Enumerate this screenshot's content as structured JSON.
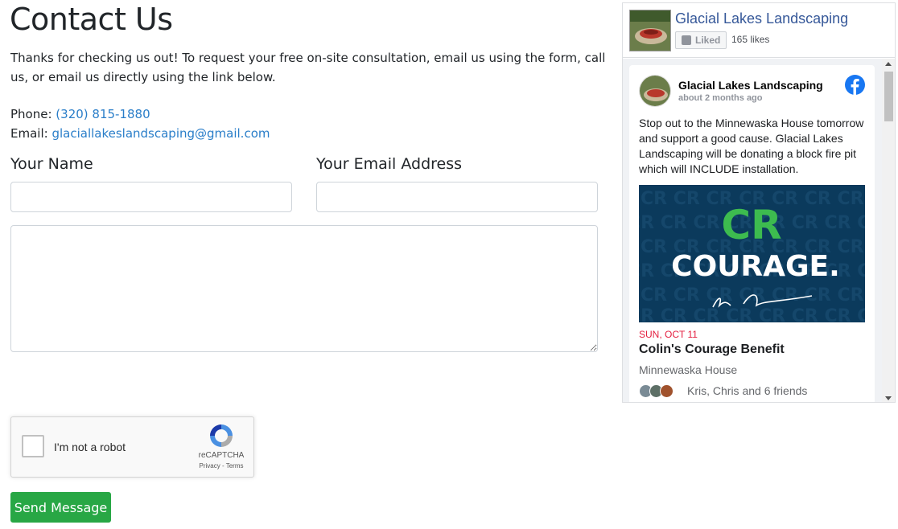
{
  "page": {
    "title": "Contact Us",
    "intro": "Thanks for checking us out! To request your free on-site consultation, email us using the form, call us, or email us directly using the link below.",
    "phone_label": "Phone",
    "phone": "(320) 815-1880",
    "email_label": "Email",
    "email": "glaciallakeslandscaping@gmail.com"
  },
  "form": {
    "name_label": "Your Name",
    "name_value": "",
    "email_label": "Your Email Address",
    "email_value": "",
    "message_value": "",
    "recaptcha_label": "I'm not a robot",
    "recaptcha_brand": "reCAPTCHA",
    "recaptcha_links": "Privacy - Terms",
    "submit_label": "Send Message",
    "submit_color": "#28a745"
  },
  "facebook_widget": {
    "page_name": "Glacial Lakes Landscaping",
    "liked_label": "Liked",
    "likes_count": "165 likes",
    "brand_color": "#1877f2",
    "post": {
      "author": "Glacial Lakes Landscaping",
      "time": "about 2 months ago",
      "text": "Stop out to the Minnewaska House tomorrow and support a good cause. Glacial Lakes Landscaping will be donating a block fire pit which will INCLUDE installation.",
      "event": {
        "image_logo_top": "CR",
        "image_logo_bottom": "COURAGE.",
        "date": "SUN, OCT 11",
        "title": "Colin's Courage Benefit",
        "venue": "Minnewaska House",
        "friends": "Kris, Chris and 6 friends"
      }
    }
  },
  "icons": [
    "facebook-logo-icon",
    "thumbs-up-icon",
    "recaptcha-logo-icon",
    "resize-grip-icon",
    "scroll-up-icon",
    "scroll-down-icon"
  ]
}
